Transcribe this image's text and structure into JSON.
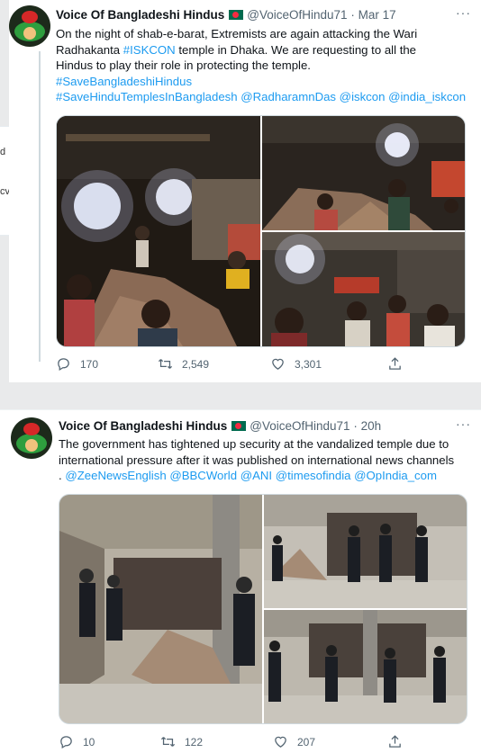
{
  "tweets": [
    {
      "author_name": "Voice Of Bangladeshi Hindus",
      "flag_icon": "bangladesh-flag-icon",
      "handle": "@VoiceOfHindu71",
      "separator": "·",
      "time": "Mar 17",
      "body_lines": [
        [
          {
            "t": "On the night of shab-e-barat, Extremists are again attacking the Wari"
          }
        ],
        [
          {
            "t": "Radhakanta "
          },
          {
            "t": "#ISKCON",
            "link": true
          },
          {
            "t": " temple in Dhaka. We are  requesting to all the"
          }
        ],
        [
          {
            "t": "Hindus to play their role in protecting the temple."
          }
        ],
        [
          {
            "t": "#SaveBangladeshiHindus",
            "link": true
          }
        ],
        [
          {
            "t": "#SaveHinduTemplesInBangladesh @RadharamnDas @iskcon @india_iskcon",
            "link": true
          }
        ]
      ],
      "replies": "170",
      "retweets": "2,549",
      "likes": "3,301"
    },
    {
      "author_name": "Voice Of Bangladeshi Hindus",
      "flag_icon": "bangladesh-flag-icon",
      "handle": "@VoiceOfHindu71",
      "separator": "·",
      "time": "20h",
      "body_lines": [
        [
          {
            "t": "The government has tightened up security at the vandalized temple due to"
          }
        ],
        [
          {
            "t": "international pressure after it was published on international news channels"
          }
        ],
        [
          {
            "t": ". "
          },
          {
            "t": "@ZeeNewsEnglish @BBCWorld @ANI @timesofindia @OpIndia_com",
            "link": true
          }
        ]
      ],
      "replies": "10",
      "retweets": "122",
      "likes": "207"
    }
  ],
  "colors": {
    "link": "#1d9bf0",
    "muted": "#536471",
    "text": "#0f1419"
  },
  "left_edge_fragments": [
    "d",
    "cv"
  ]
}
